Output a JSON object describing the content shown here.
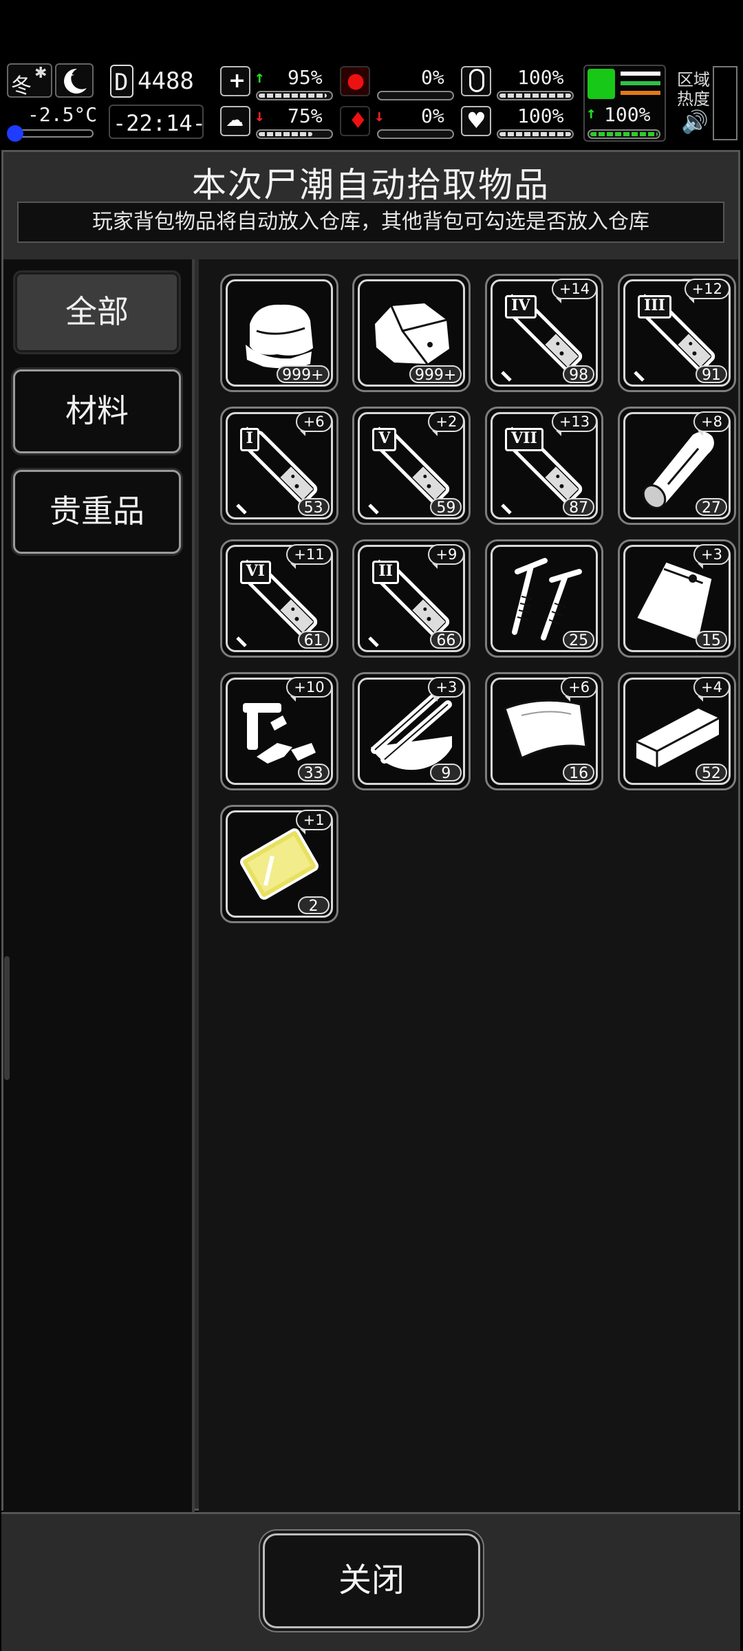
{
  "hud": {
    "season": "冬",
    "temperature": "-2.5°C",
    "day_counter": "4488",
    "clock": "-22:14-",
    "health_pct": "95%",
    "stomach_pct": "0%",
    "pill_pct": "100%",
    "sanity_pct": "75%",
    "blood_pct": "0%",
    "heart_pct": "100%",
    "stamina_pct": "100%",
    "zone_heat_label": "区域热度",
    "icons": [
      "snowflake-icon",
      "moon-icon",
      "day-icon",
      "medkit-icon",
      "stomach-icon",
      "pill-icon",
      "brain-icon",
      "blood-icon",
      "heart-icon",
      "boot-icon",
      "speaker-icon"
    ],
    "bars": {
      "health": 0.95,
      "stomach": 0.0,
      "pill": 1.0,
      "sanity": 0.75,
      "blood": 0.0,
      "heart": 1.0,
      "stamina": 1.0
    }
  },
  "panel": {
    "title": "本次尸潮自动拾取物品",
    "subtitle": "玩家背包物品将自动放入仓库，其他背包可勾选是否放入仓库"
  },
  "tabs": [
    {
      "label": "全部",
      "active": true
    },
    {
      "label": "材料",
      "active": false
    },
    {
      "label": "贵重品",
      "active": false
    }
  ],
  "items": [
    {
      "icon": "cloth-icon",
      "count": "999+",
      "bonus": ""
    },
    {
      "icon": "rock-icon",
      "count": "999+",
      "bonus": ""
    },
    {
      "icon": "syringe-iv-icon",
      "roman": "IV",
      "count": "98",
      "bonus": "+14"
    },
    {
      "icon": "syringe-iii-icon",
      "roman": "III",
      "count": "91",
      "bonus": "+12"
    },
    {
      "icon": "syringe-i-icon",
      "roman": "I",
      "count": "53",
      "bonus": "+6"
    },
    {
      "icon": "syringe-v-icon",
      "roman": "V",
      "count": "59",
      "bonus": "+2"
    },
    {
      "icon": "syringe-vii-icon",
      "roman": "VII",
      "count": "87",
      "bonus": "+13"
    },
    {
      "icon": "wood-log-icon",
      "count": "27",
      "bonus": "+8"
    },
    {
      "icon": "syringe-vi-icon",
      "roman": "VI",
      "count": "61",
      "bonus": "+11"
    },
    {
      "icon": "syringe-ii-icon",
      "roman": "II",
      "count": "66",
      "bonus": "+9"
    },
    {
      "icon": "screws-icon",
      "count": "25",
      "bonus": ""
    },
    {
      "icon": "bag-icon",
      "count": "15",
      "bonus": "+3"
    },
    {
      "icon": "scrap-pipes-icon",
      "count": "33",
      "bonus": "+10"
    },
    {
      "icon": "plank-bundle-icon",
      "count": "9",
      "bonus": "+3"
    },
    {
      "icon": "fabric-sheet-icon",
      "count": "16",
      "bonus": "+6"
    },
    {
      "icon": "board-icon",
      "count": "52",
      "bonus": "+4"
    },
    {
      "icon": "gold-plate-icon",
      "count": "2",
      "bonus": "+1"
    }
  ],
  "footer": {
    "close_label": "关闭"
  }
}
